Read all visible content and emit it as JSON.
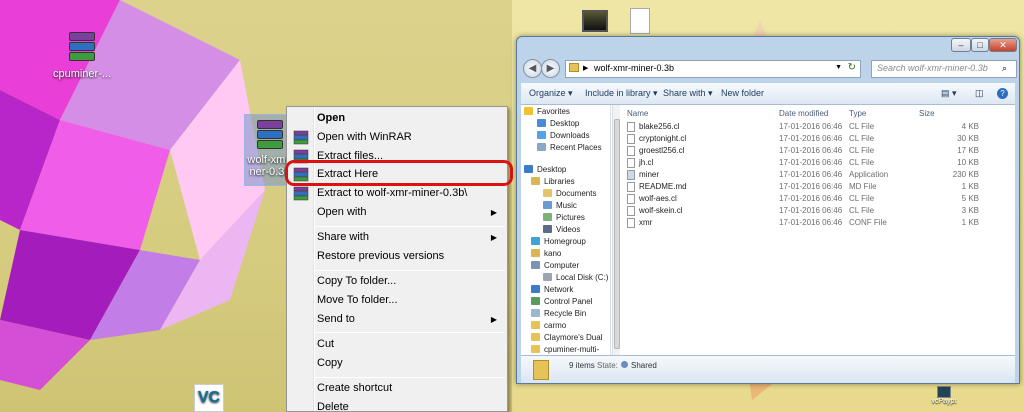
{
  "desktop": {
    "icons": [
      {
        "label": "cpuminer-..."
      },
      {
        "label_line1": "wolf-xmr-",
        "label_line2": "ner-0.3b"
      },
      {
        "label": "vcPaypt"
      }
    ]
  },
  "context_menu": {
    "items": [
      {
        "label": "Open",
        "bold": true
      },
      {
        "label": "Open with WinRAR",
        "icon": "winrar-icon"
      },
      {
        "label": "Extract files...",
        "icon": "winrar-icon"
      },
      {
        "label": "Extract Here",
        "icon": "winrar-icon",
        "highlighted": true
      },
      {
        "label": "Extract to wolf-xmr-miner-0.3b\\",
        "icon": "winrar-icon"
      },
      {
        "label": "Open with",
        "submenu": true
      },
      {
        "label": "Share with",
        "submenu": true
      },
      {
        "label": "Restore previous versions"
      },
      {
        "label": "Copy To folder..."
      },
      {
        "label": "Move To folder..."
      },
      {
        "label": "Send to",
        "submenu": true
      },
      {
        "label": "Cut"
      },
      {
        "label": "Copy"
      },
      {
        "label": "Create shortcut"
      },
      {
        "label": "Delete"
      }
    ],
    "highlight_color": "#dd1111"
  },
  "explorer": {
    "address": "wolf-xmr-miner-0.3b",
    "search_placeholder": "Search wolf-xmr-miner-0.3b",
    "toolbar": {
      "organize": "Organize",
      "include": "Include in library",
      "share": "Share with",
      "new_folder": "New folder"
    },
    "nav": {
      "favorites": "Favorites",
      "desktop_fav": "Desktop",
      "downloads": "Downloads",
      "recent": "Recent Places",
      "desktop": "Desktop",
      "libraries": "Libraries",
      "documents": "Documents",
      "music": "Music",
      "pictures": "Pictures",
      "videos": "Videos",
      "homegroup": "Homegroup",
      "kano": "kano",
      "computer": "Computer",
      "local_disk": "Local Disk (C:)",
      "network": "Network",
      "control_panel": "Control Panel",
      "recycle_bin": "Recycle Bin",
      "carmo": "carmo",
      "claymore": "Claymore's Dual",
      "cpuminer": "cpuminer-multi-"
    },
    "columns": {
      "name": "Name",
      "date": "Date modified",
      "type": "Type",
      "size": "Size"
    },
    "files": [
      {
        "name": "blake256.cl",
        "date": "17-01-2016 06:46",
        "type": "CL File",
        "size": "4 KB"
      },
      {
        "name": "cryptonight.cl",
        "date": "17-01-2016 06:46",
        "type": "CL File",
        "size": "30 KB"
      },
      {
        "name": "groestl256.cl",
        "date": "17-01-2016 06:46",
        "type": "CL File",
        "size": "17 KB"
      },
      {
        "name": "jh.cl",
        "date": "17-01-2016 06:46",
        "type": "CL File",
        "size": "10 KB"
      },
      {
        "name": "miner",
        "date": "17-01-2016 06:46",
        "type": "Application",
        "size": "230 KB"
      },
      {
        "name": "README.md",
        "date": "17-01-2016 06:46",
        "type": "MD File",
        "size": "1 KB"
      },
      {
        "name": "wolf-aes.cl",
        "date": "17-01-2016 06:46",
        "type": "CL File",
        "size": "5 KB"
      },
      {
        "name": "wolf-skein.cl",
        "date": "17-01-2016 06:46",
        "type": "CL File",
        "size": "3 KB"
      },
      {
        "name": "xmr",
        "date": "17-01-2016 06:46",
        "type": "CONF File",
        "size": "1 KB"
      }
    ],
    "status": {
      "count": "9 items",
      "state_label": "State:",
      "state_value": "Shared"
    }
  }
}
